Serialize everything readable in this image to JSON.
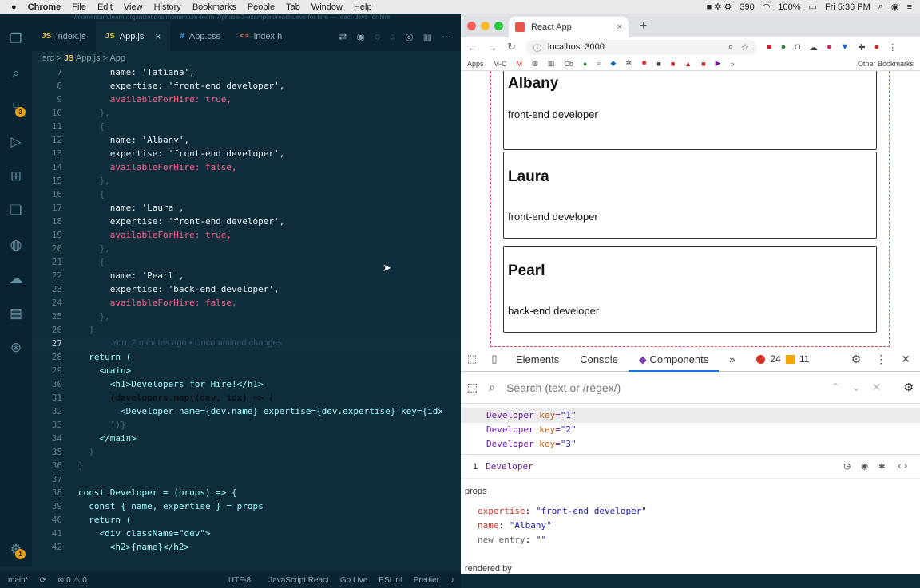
{
  "menubar": {
    "apple": "",
    "app": "Chrome",
    "items": [
      "File",
      "Edit",
      "View",
      "History",
      "Bookmarks",
      "People",
      "Tab",
      "Window",
      "Help"
    ],
    "status_count": "390",
    "battery": "100%",
    "clock": "Fri 5:36 PM"
  },
  "vscode": {
    "title": "~/momentum/team-organizations/momentum-team-7/phase-3-examples/react-devs-for-hire — react-devs-for-hire",
    "activity_badge": "3",
    "activity_badge_bottom": "1",
    "tabs": [
      {
        "type": "JS",
        "label": "index.js"
      },
      {
        "type": "JS",
        "label": "App.js",
        "close": "×"
      },
      {
        "type": "#",
        "label": "App.css"
      },
      {
        "type": "<>",
        "label": "index.h"
      }
    ],
    "breadcrumb": {
      "src": "src",
      "sep": ">",
      "file": "App.js",
      "symbol": "App"
    },
    "git_blame": "You, 2 minutes ago • Uncommitted changes",
    "code_lines": [
      {
        "n": "7",
        "code": "      name: 'Tatiana',"
      },
      {
        "n": "8",
        "code": "      expertise: 'front-end developer',"
      },
      {
        "n": "9",
        "code": "      availableForHire: true,"
      },
      {
        "n": "10",
        "code": "    },"
      },
      {
        "n": "11",
        "code": "    {"
      },
      {
        "n": "12",
        "code": "      name: 'Albany',"
      },
      {
        "n": "13",
        "code": "      expertise: 'front-end developer',"
      },
      {
        "n": "14",
        "code": "      availableForHire: false,"
      },
      {
        "n": "15",
        "code": "    },"
      },
      {
        "n": "16",
        "code": "    {"
      },
      {
        "n": "17",
        "code": "      name: 'Laura',"
      },
      {
        "n": "18",
        "code": "      expertise: 'front-end developer',"
      },
      {
        "n": "19",
        "code": "      availableForHire: true,"
      },
      {
        "n": "20",
        "code": "    },"
      },
      {
        "n": "21",
        "code": "    {"
      },
      {
        "n": "22",
        "code": "      name: 'Pearl',"
      },
      {
        "n": "23",
        "code": "      expertise: 'back-end developer',"
      },
      {
        "n": "24",
        "code": "      availableForHire: false,"
      },
      {
        "n": "25",
        "code": "    },"
      },
      {
        "n": "26",
        "code": "  ]"
      },
      {
        "n": "27",
        "code": ""
      },
      {
        "n": "28",
        "code": "  return ("
      },
      {
        "n": "29",
        "code": "    <main>"
      },
      {
        "n": "30",
        "code": "      <h1>Developers for Hire!</h1>"
      },
      {
        "n": "31",
        "code": "      {developers.map((dev, idx) => ("
      },
      {
        "n": "32",
        "code": "        <Developer name={dev.name} expertise={dev.expertise} key={idx"
      },
      {
        "n": "33",
        "code": "      ))}"
      },
      {
        "n": "34",
        "code": "    </main>"
      },
      {
        "n": "35",
        "code": "  )"
      },
      {
        "n": "36",
        "code": "}"
      },
      {
        "n": "37",
        "code": ""
      },
      {
        "n": "38",
        "code": "const Developer = (props) => {"
      },
      {
        "n": "39",
        "code": "  const { name, expertise } = props"
      },
      {
        "n": "40",
        "code": "  return ("
      },
      {
        "n": "41",
        "code": "    <div className=\"dev\">"
      },
      {
        "n": "42",
        "code": "      <h2>{name}</h2>"
      }
    ],
    "status": {
      "branch": "main*",
      "sync": "⟳",
      "problems": "⊗ 0 ⚠ 0",
      "encoding": "UTF-8",
      "language": "JavaScript React",
      "golive": "Go Live",
      "eslint": "ESLint",
      "prettier": "Prettier"
    }
  },
  "chrome": {
    "tab_title": "React App",
    "tab_close": "×",
    "new_tab": "+",
    "url": "localhost:3000",
    "bookmarks": [
      "Apps",
      "M-C"
    ],
    "other_bookmarks": "Other Bookmarks",
    "more": "»",
    "cards": [
      {
        "name": "Albany",
        "expertise": "front-end developer"
      },
      {
        "name": "Laura",
        "expertise": "front-end developer"
      },
      {
        "name": "Pearl",
        "expertise": "back-end developer"
      }
    ]
  },
  "devtools": {
    "tabs": [
      "Elements",
      "Console",
      "Components"
    ],
    "more": "»",
    "errors": "24",
    "warnings": "11",
    "search_placeholder": "Search (text or /regex/)",
    "tree": [
      {
        "comp": "Developer",
        "attr": "key",
        "val": "\"1\""
      },
      {
        "comp": "Developer",
        "attr": "key",
        "val": "\"2\""
      },
      {
        "comp": "Developer",
        "attr": "key",
        "val": "\"3\""
      }
    ],
    "selected_index": "1",
    "selected_component": "Developer",
    "props_label": "props",
    "props": [
      {
        "key": "expertise",
        "val": "\"front-end developer\""
      },
      {
        "key": "name",
        "val": "\"Albany\""
      },
      {
        "key": "new entry",
        "val": "\"\""
      }
    ],
    "rendered_by": "rendered by"
  }
}
